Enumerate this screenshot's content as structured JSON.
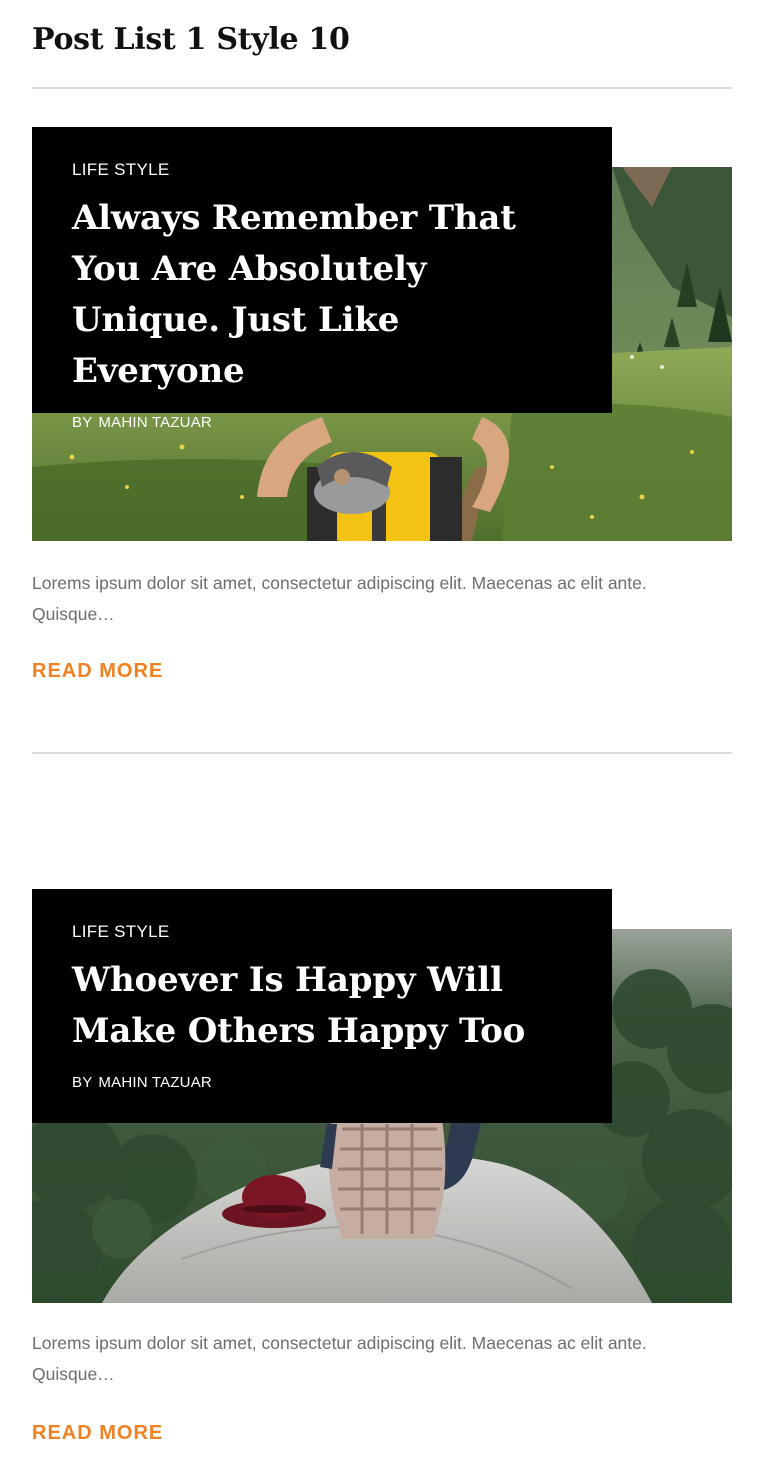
{
  "section": {
    "title": "Post List 1 Style 10"
  },
  "posts": [
    {
      "category": "LIFE STYLE",
      "title": "Always Remember That You Are Absolutely Unique. Just Like Everyone",
      "by_label": "BY",
      "author": "MAHIN TAZUAR",
      "excerpt": "Lorems ipsum dolor sit amet, consectetur adipiscing elit. Maecenas ac elit ante. Quisque…",
      "read_more": "READ MORE",
      "image": "hiker-with-yellow-backpack-in-green-valley"
    },
    {
      "category": "LIFE STYLE",
      "title": "Whoever Is Happy Will Make Others Happy Too",
      "by_label": "BY",
      "author": "MAHIN TAZUAR",
      "excerpt": "Lorems ipsum dolor sit amet, consectetur adipiscing elit. Maecenas ac elit ante. Quisque…",
      "read_more": "READ MORE",
      "image": "person-sitting-on-rock-with-red-hat-over-forest"
    }
  ],
  "colors": {
    "accent": "#f08224",
    "overlay": "#000000",
    "excerpt": "#6e6e6e",
    "divider": "#dcdcdc"
  }
}
